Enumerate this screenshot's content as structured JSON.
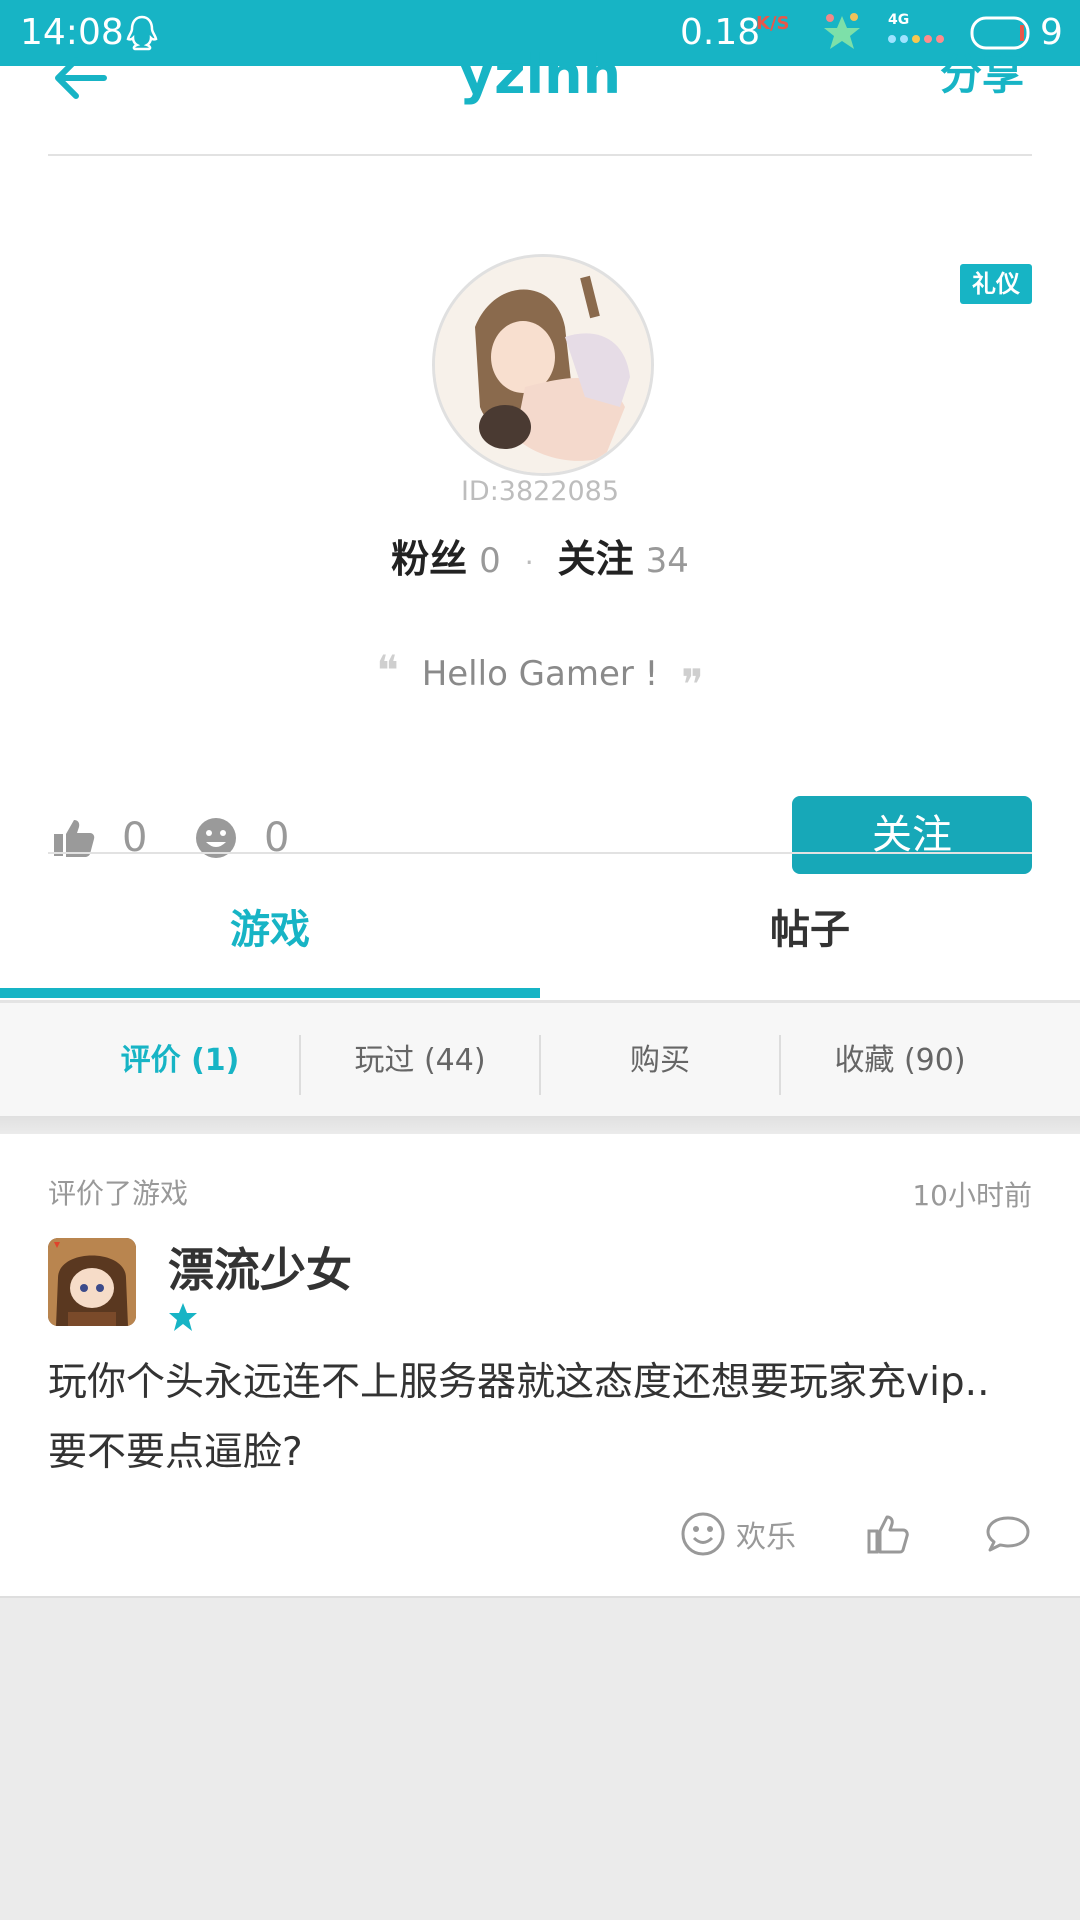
{
  "status_bar": {
    "time": "14:08",
    "speed": "0.18",
    "speed_unit": "K/S",
    "signal_label": "4G",
    "battery": "9"
  },
  "header": {
    "title": "yzlnh",
    "share_label": "分享"
  },
  "profile": {
    "badge": "礼仪",
    "user_id": "ID:3822085",
    "fans_label": "粉丝",
    "fans_count": "0",
    "follow_label": "关注",
    "follow_count": "34",
    "signature": "Hello Gamer !",
    "likes": "0",
    "funny": "0",
    "follow_button": "关注"
  },
  "tabs": [
    {
      "label": "游戏",
      "active": true
    },
    {
      "label": "帖子",
      "active": false
    }
  ],
  "subtabs": [
    {
      "label": "评价 (1)",
      "active": true
    },
    {
      "label": "玩过 (44)",
      "active": false
    },
    {
      "label": "购买",
      "active": false
    },
    {
      "label": "收藏 (90)",
      "active": false
    }
  ],
  "review_card": {
    "action": "评价了游戏",
    "time": "10小时前",
    "game_name": "漂流少女",
    "rating": 1,
    "text": "玩你个头永远连不上服务器就这态度还想要玩家充vip..要不要点逼脸?",
    "reaction_label": "欢乐"
  },
  "colors": {
    "accent": "#17b4c5",
    "button": "#17a8b8"
  }
}
